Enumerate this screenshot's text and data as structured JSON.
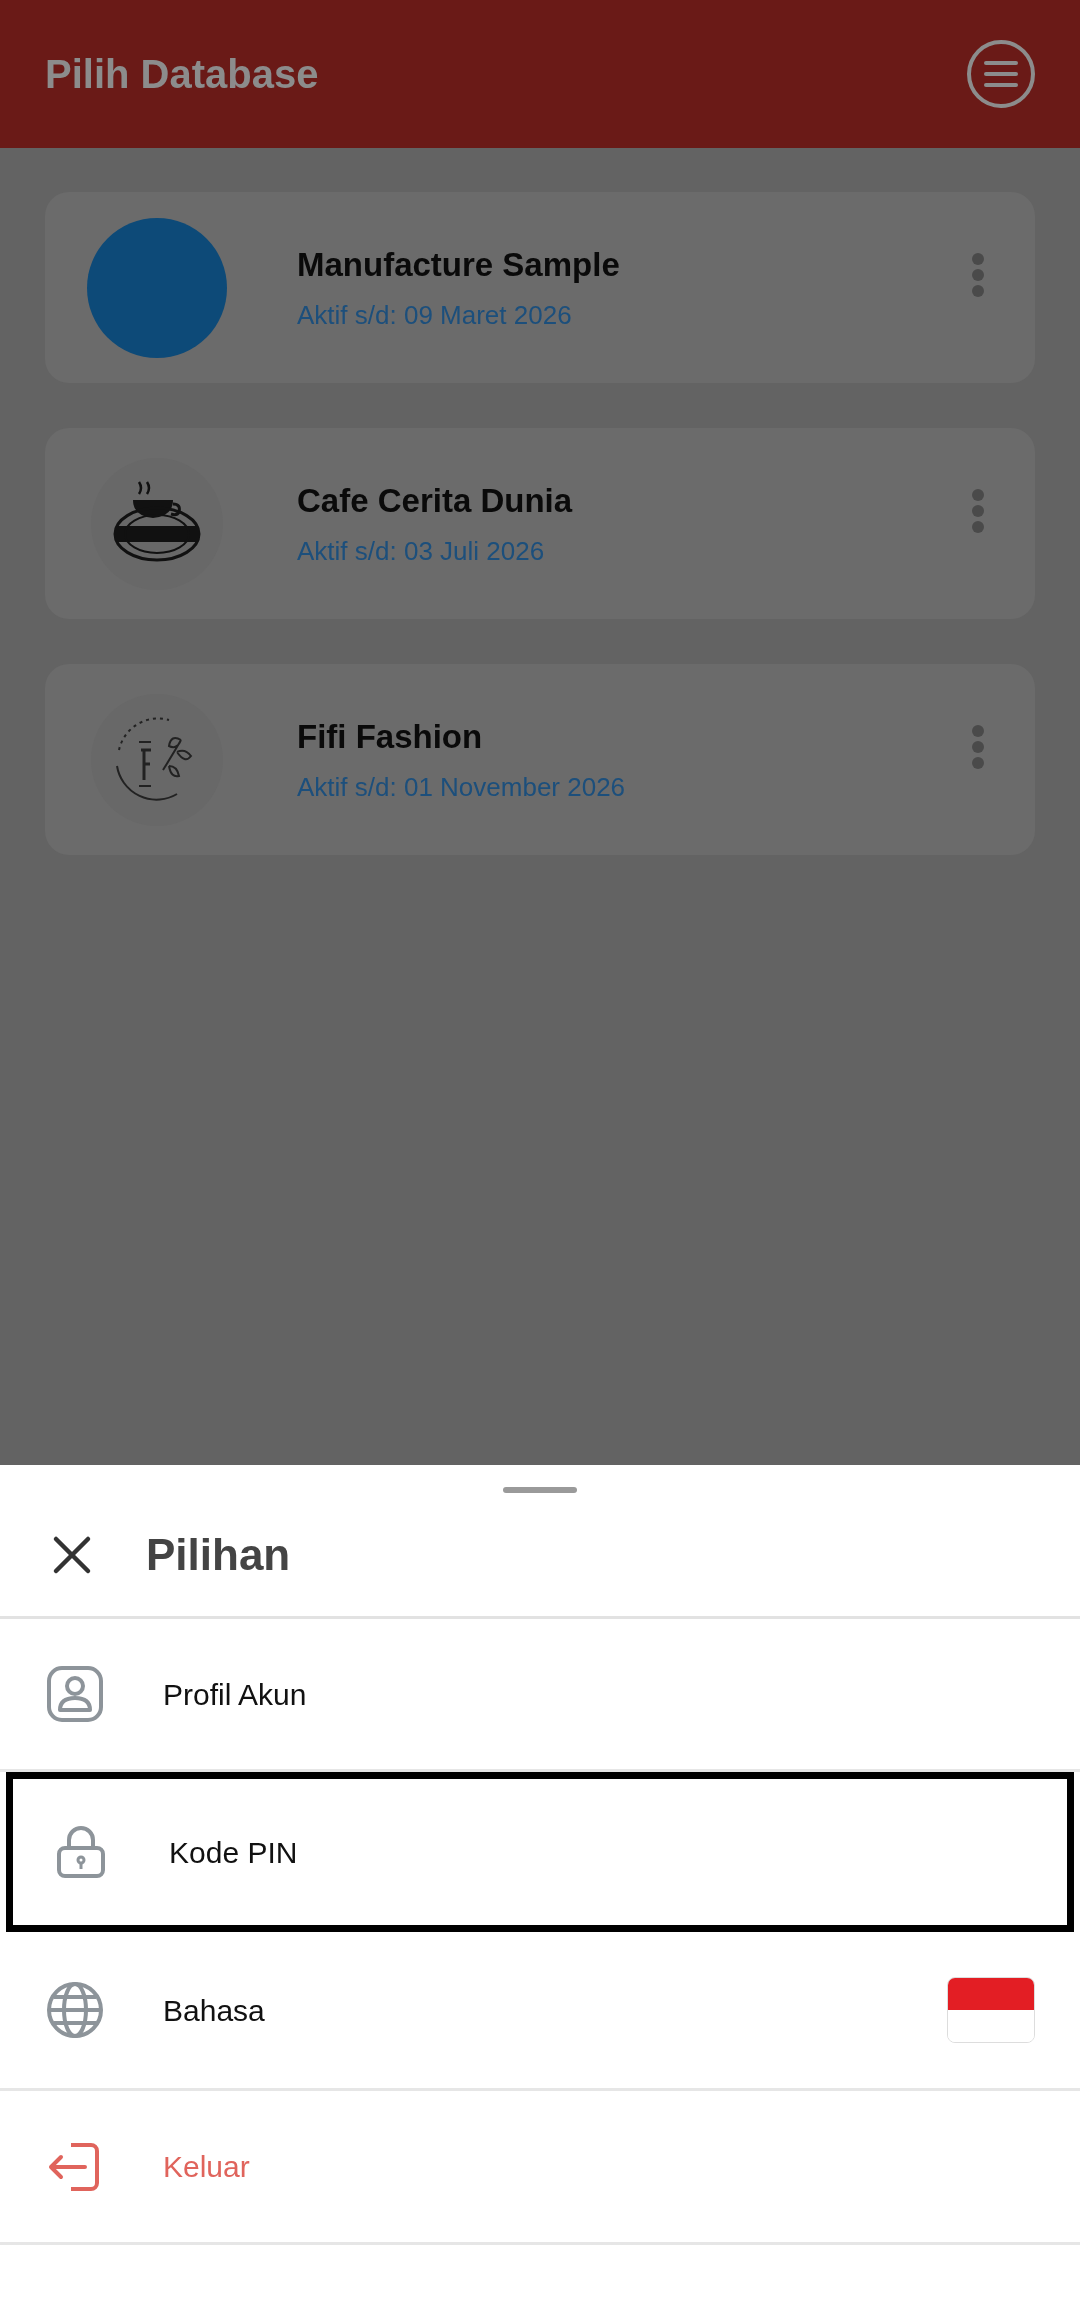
{
  "header": {
    "title": "Pilih Database"
  },
  "databases": [
    {
      "name": "Manufacture Sample",
      "active_until": "Aktif s/d: 09 Maret 2026",
      "kind": "circle",
      "color": "#0d4a78"
    },
    {
      "name": "Cafe Cerita Dunia",
      "active_until": "Aktif s/d: 03 Juli 2026",
      "kind": "cafe-logo"
    },
    {
      "name": "Fifi Fashion",
      "active_until": "Aktif s/d: 01 November 2026",
      "kind": "fashion-logo"
    }
  ],
  "sheet": {
    "title": "Pilihan",
    "items": [
      {
        "label": "Profil Akun",
        "kind": "plain",
        "selected": false
      },
      {
        "label": "Kode PIN",
        "kind": "plain",
        "selected": true
      },
      {
        "label": "Bahasa",
        "kind": "language",
        "selected": false
      },
      {
        "label": "Keluar",
        "kind": "danger",
        "selected": false
      }
    ]
  }
}
